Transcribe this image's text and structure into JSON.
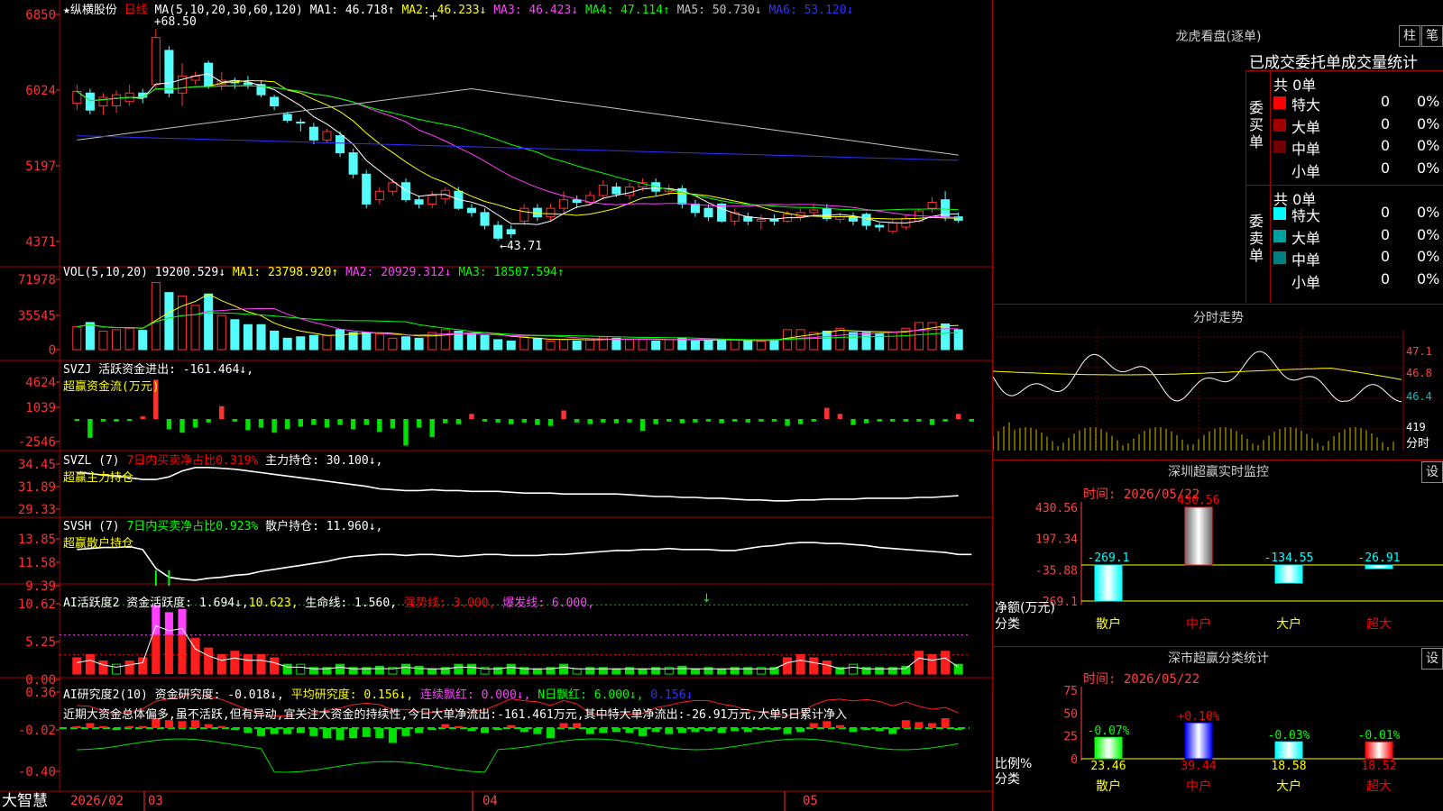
{
  "header": {
    "star": "★",
    "stock_name": "纵横股份",
    "period": "日线",
    "ma_label": "MA(5,10,20,30,60,120)",
    "ma_items": [
      {
        "label": "MA1: 46.718↑",
        "color": "#ffffff"
      },
      {
        "label": "MA2: 46.233↓",
        "color": "#ffff00"
      },
      {
        "label": "MA3: 46.423↓",
        "color": "#ff40ff"
      },
      {
        "label": "MA4: 47.114↑",
        "color": "#00ff00"
      },
      {
        "label": "MA5: 50.730↓",
        "color": "#c0c0c0"
      },
      {
        "label": "MA6: 53.120↓",
        "color": "#3030ff"
      }
    ]
  },
  "volume": {
    "label": "VOL(5,10,20)",
    "items": [
      {
        "label": "19200.529↓",
        "color": "#ffffff"
      },
      {
        "label": "MA1: 23798.920↑",
        "color": "#ffff00"
      },
      {
        "label": "MA2: 20929.312↓",
        "color": "#ff40ff"
      },
      {
        "label": "MA3: 18507.594↑",
        "color": "#00ff00"
      }
    ],
    "ticks": [
      "71978",
      "35545",
      "0"
    ]
  },
  "svzj": {
    "label": "SVZJ  活跃资金进出: -161.464↓,",
    "sub": "超赢资金流(万元)",
    "ticks": [
      "4624",
      "1039",
      "-2546"
    ]
  },
  "svzl": {
    "label": "SVZL (7)",
    "red_part": "7日内买卖净占比0.319%",
    "rest": "主力持仓: 30.100↓,",
    "sub": "超赢主力持仓",
    "ticks": [
      "34.45",
      "31.89",
      "29.33"
    ]
  },
  "svsh": {
    "label": "SVSH (7)",
    "green_part": "7日内买卖净占比0.923%",
    "rest": "散户持仓: 11.960↓,",
    "sub": "超赢散户持仓",
    "ticks": [
      "13.85",
      "11.58",
      "9.39"
    ]
  },
  "ai1": {
    "label": "AI活跃度2 资金活跃度: 1.694↓,",
    "val2": "10.623,",
    "life": "生命线: 1.560,",
    "strong": "强势线: 3.000,",
    "burst": "爆发线: 6.000,",
    "ticks": [
      "10.62",
      "5.25",
      "0.00"
    ]
  },
  "ai2": {
    "label": "AI研究度2(10) 资金研究度: -0.018↓,",
    "avg": "平均研究度: 0.156↓,",
    "cont": "连续飘红: 0.000↓,",
    "nday": "N日飘红: 6.000↓,",
    "last": "0.156↓",
    "text": "近期大资金总体偏多,虽不活跃,但有异动,宜关注大资金的持续性,今日大单净流出:-161.461万元,其中特大单净流出:-26.91万元,大单5日累计净入",
    "ticks": [
      "0.36",
      "-0.02",
      "-0.40"
    ]
  },
  "bottom": {
    "logo": "大智慧",
    "year": "2026/02",
    "m3": "03",
    "m4": "04",
    "m5": "05"
  },
  "chart_data": {
    "type": "candlestick",
    "y_ticks": [
      "6850",
      "6024",
      "5197",
      "4371"
    ],
    "high_label": "68.50",
    "low_label": "←43.71",
    "candles": [
      {
        "o": 59.8,
        "c": 61.2,
        "h": 62.0,
        "l": 59.0
      },
      {
        "o": 61.0,
        "c": 59.0,
        "h": 61.5,
        "l": 58.5
      },
      {
        "o": 59.5,
        "c": 60.5,
        "h": 61.0,
        "l": 58.5
      },
      {
        "o": 59.5,
        "c": 60.8,
        "h": 61.3,
        "l": 58.7
      },
      {
        "o": 60.0,
        "c": 61.0,
        "h": 62.0,
        "l": 59.5
      },
      {
        "o": 61.0,
        "c": 60.5,
        "h": 61.5,
        "l": 59.8
      },
      {
        "o": 62.0,
        "c": 67.5,
        "h": 68.5,
        "l": 61.5
      },
      {
        "o": 66.0,
        "c": 61.0,
        "h": 66.5,
        "l": 60.5
      },
      {
        "o": 61.0,
        "c": 63.0,
        "h": 64.5,
        "l": 59.5
      },
      {
        "o": 62.5,
        "c": 63.0,
        "h": 63.5,
        "l": 62.0
      },
      {
        "o": 64.5,
        "c": 61.8,
        "h": 64.8,
        "l": 61.5
      },
      {
        "o": 62.0,
        "c": 62.5,
        "h": 63.5,
        "l": 61.3
      },
      {
        "o": 62.3,
        "c": 62.2,
        "h": 62.8,
        "l": 61.5
      },
      {
        "o": 62.2,
        "c": 62.0,
        "h": 63.0,
        "l": 61.5
      },
      {
        "o": 62.0,
        "c": 60.8,
        "h": 62.5,
        "l": 60.5
      },
      {
        "o": 60.5,
        "c": 59.5,
        "h": 60.8,
        "l": 59.0
      },
      {
        "o": 58.5,
        "c": 57.8,
        "h": 58.8,
        "l": 57.5
      },
      {
        "o": 57.6,
        "c": 57.5,
        "h": 58.0,
        "l": 56.5
      },
      {
        "o": 57.0,
        "c": 55.5,
        "h": 57.5,
        "l": 55.0
      },
      {
        "o": 55.5,
        "c": 56.5,
        "h": 56.8,
        "l": 55.2
      },
      {
        "o": 56.0,
        "c": 54.0,
        "h": 56.5,
        "l": 53.5
      },
      {
        "o": 54.0,
        "c": 51.5,
        "h": 54.5,
        "l": 51.0
      },
      {
        "o": 51.5,
        "c": 48.0,
        "h": 52.0,
        "l": 47.5
      },
      {
        "o": 48.5,
        "c": 49.5,
        "h": 50.0,
        "l": 48.0
      },
      {
        "o": 49.5,
        "c": 50.5,
        "h": 51.0,
        "l": 49.0
      },
      {
        "o": 50.5,
        "c": 48.5,
        "h": 51.0,
        "l": 48.2
      },
      {
        "o": 48.5,
        "c": 48.0,
        "h": 49.0,
        "l": 47.5
      },
      {
        "o": 48.0,
        "c": 49.0,
        "h": 49.5,
        "l": 47.5
      },
      {
        "o": 48.6,
        "c": 49.6,
        "h": 50.0,
        "l": 48.0
      },
      {
        "o": 49.5,
        "c": 47.5,
        "h": 50.0,
        "l": 47.3
      },
      {
        "o": 47.5,
        "c": 47.0,
        "h": 48.0,
        "l": 46.5
      },
      {
        "o": 47.0,
        "c": 45.5,
        "h": 47.5,
        "l": 45.0
      },
      {
        "o": 45.5,
        "c": 44.0,
        "h": 46.0,
        "l": 43.71
      },
      {
        "o": 45.0,
        "c": 44.5,
        "h": 45.5,
        "l": 44.0
      },
      {
        "o": 46.0,
        "c": 47.5,
        "h": 48.0,
        "l": 45.5
      },
      {
        "o": 47.5,
        "c": 46.5,
        "h": 48.0,
        "l": 46.0
      },
      {
        "o": 46.5,
        "c": 47.5,
        "h": 48.0,
        "l": 46.0
      },
      {
        "o": 47.5,
        "c": 48.5,
        "h": 49.5,
        "l": 47.0
      },
      {
        "o": 48.5,
        "c": 48.2,
        "h": 49.0,
        "l": 47.5
      },
      {
        "o": 48.2,
        "c": 49.0,
        "h": 49.5,
        "l": 47.8
      },
      {
        "o": 49.0,
        "c": 50.2,
        "h": 50.8,
        "l": 48.5
      },
      {
        "o": 50.0,
        "c": 49.2,
        "h": 50.5,
        "l": 48.8
      },
      {
        "o": 49.0,
        "c": 50.0,
        "h": 50.5,
        "l": 48.5
      },
      {
        "o": 50.0,
        "c": 50.5,
        "h": 51.0,
        "l": 49.5
      },
      {
        "o": 50.5,
        "c": 49.5,
        "h": 51.0,
        "l": 49.0
      },
      {
        "o": 49.5,
        "c": 49.8,
        "h": 50.3,
        "l": 49.0
      },
      {
        "o": 49.8,
        "c": 48.0,
        "h": 50.2,
        "l": 47.5
      },
      {
        "o": 48.0,
        "c": 47.0,
        "h": 48.5,
        "l": 46.5
      },
      {
        "o": 47.5,
        "c": 46.5,
        "h": 48.0,
        "l": 46.0
      },
      {
        "o": 48.0,
        "c": 46.0,
        "h": 48.2,
        "l": 45.8
      },
      {
        "o": 46.0,
        "c": 47.0,
        "h": 47.5,
        "l": 45.5
      },
      {
        "o": 46.5,
        "c": 46.0,
        "h": 47.0,
        "l": 45.5
      },
      {
        "o": 46.0,
        "c": 46.2,
        "h": 46.8,
        "l": 45.0
      },
      {
        "o": 46.2,
        "c": 46.0,
        "h": 46.8,
        "l": 45.5
      },
      {
        "o": 46.0,
        "c": 46.8,
        "h": 47.2,
        "l": 45.8
      },
      {
        "o": 46.5,
        "c": 47.0,
        "h": 47.5,
        "l": 46.0
      },
      {
        "o": 47.0,
        "c": 47.3,
        "h": 48.0,
        "l": 46.5
      },
      {
        "o": 47.5,
        "c": 46.3,
        "h": 48.0,
        "l": 46.0
      },
      {
        "o": 46.2,
        "c": 46.5,
        "h": 47.0,
        "l": 45.8
      },
      {
        "o": 46.5,
        "c": 46.0,
        "h": 47.0,
        "l": 45.5
      },
      {
        "o": 46.8,
        "c": 45.5,
        "h": 47.0,
        "l": 45.0
      },
      {
        "o": 45.5,
        "c": 45.3,
        "h": 45.8,
        "l": 44.8
      },
      {
        "o": 44.8,
        "c": 45.8,
        "h": 46.2,
        "l": 44.5
      },
      {
        "o": 45.3,
        "c": 46.3,
        "h": 46.8,
        "l": 45.0
      },
      {
        "o": 46.0,
        "c": 47.2,
        "h": 47.5,
        "l": 45.8
      },
      {
        "o": 47.5,
        "c": 48.2,
        "h": 48.8,
        "l": 47.0
      },
      {
        "o": 48.5,
        "c": 46.5,
        "h": 49.5,
        "l": 46.0
      },
      {
        "o": 46.5,
        "c": 46.1,
        "h": 47.0,
        "l": 45.8
      }
    ],
    "volume": [
      32,
      38,
      26,
      28,
      30,
      27,
      94,
      80,
      75,
      62,
      78,
      48,
      42,
      35,
      35,
      26,
      16,
      18,
      20,
      20,
      28,
      24,
      24,
      22,
      16,
      18,
      16,
      24,
      28,
      26,
      22,
      20,
      14,
      12,
      18,
      16,
      12,
      14,
      12,
      14,
      18,
      16,
      14,
      14,
      12,
      14,
      16,
      12,
      12,
      14,
      14,
      12,
      12,
      14,
      28,
      28,
      24,
      26,
      30,
      24,
      24,
      22,
      24,
      30,
      38,
      38,
      36,
      28
    ],
    "svzj": [
      -200,
      -2200,
      -300,
      -300,
      -200,
      300,
      4600,
      -1200,
      -1600,
      -1000,
      -400,
      1500,
      -300,
      -1300,
      -1000,
      -1600,
      -1200,
      -900,
      -700,
      -1000,
      -700,
      -1200,
      -700,
      -1500,
      -1100,
      -3100,
      -1000,
      -2100,
      -500,
      -600,
      600,
      -300,
      -400,
      -600,
      -400,
      -700,
      -800,
      1000,
      -400,
      -600,
      -400,
      -500,
      -400,
      -1400,
      -600,
      -300,
      -500,
      -400,
      -300,
      -500,
      -300,
      -400,
      -300,
      -300,
      -800,
      -600,
      -300,
      1300,
      600,
      -700,
      -500,
      -300,
      -300,
      -300,
      -300,
      -700,
      -300,
      600,
      -300
    ],
    "svzl": [
      33.8,
      33.7,
      33.5,
      33.4,
      33.2,
      33.0,
      33.0,
      33.3,
      34.0,
      34.4,
      34.4,
      34.3,
      34.2,
      34.0,
      33.8,
      33.6,
      33.4,
      33.2,
      33.0,
      32.8,
      32.6,
      32.4,
      32.2,
      31.9,
      31.8,
      31.7,
      31.7,
      31.8,
      31.7,
      31.7,
      31.6,
      31.6,
      31.6,
      31.5,
      31.4,
      31.4,
      31.4,
      31.3,
      31.3,
      31.3,
      31.3,
      31.3,
      31.2,
      31.1,
      31.0,
      31.0,
      30.9,
      30.9,
      30.8,
      30.8,
      30.7,
      30.6,
      30.6,
      30.5,
      30.5,
      30.6,
      30.6,
      30.7,
      30.7,
      30.7,
      30.8,
      30.8,
      30.8,
      30.8,
      30.9,
      30.9,
      31.0,
      31.1
    ],
    "svsh": [
      12.4,
      12.5,
      12.6,
      12.6,
      12.7,
      12.4,
      10.5,
      9.6,
      9.4,
      9.3,
      9.5,
      9.6,
      9.8,
      9.9,
      10.2,
      10.4,
      10.6,
      10.8,
      11.0,
      11.2,
      11.5,
      11.7,
      11.8,
      11.9,
      11.9,
      11.8,
      11.9,
      11.9,
      11.8,
      11.7,
      11.8,
      11.9,
      11.9,
      11.8,
      11.8,
      11.8,
      11.9,
      11.9,
      12.0,
      12.1,
      12.2,
      12.3,
      12.3,
      12.4,
      12.4,
      12.5,
      12.4,
      12.4,
      12.4,
      12.3,
      12.3,
      12.5,
      12.7,
      12.8,
      13.0,
      13.1,
      13.1,
      13.0,
      13.0,
      12.9,
      12.8,
      12.6,
      12.5,
      12.4,
      12.3,
      12.2,
      12.1,
      11.9,
      11.9
    ],
    "ai1": [
      2.5,
      3.0,
      2.0,
      1.5,
      2.0,
      2.5,
      10.6,
      9.5,
      10.0,
      5.5,
      4.0,
      3.0,
      3.5,
      3.0,
      3.0,
      2.5,
      1.5,
      1.5,
      1.0,
      1.0,
      1.5,
      1.0,
      1.0,
      1.2,
      1.0,
      1.5,
      1.2,
      0.8,
      1.0,
      1.5,
      1.5,
      1.0,
      1.0,
      1.5,
      1.0,
      0.8,
      1.0,
      1.5,
      0.8,
      1.0,
      1.0,
      0.8,
      1.0,
      0.8,
      1.0,
      1.0,
      1.2,
      0.8,
      1.0,
      0.8,
      1.0,
      1.0,
      1.0,
      1.0,
      2.5,
      3.0,
      2.5,
      2.0,
      1.0,
      1.5,
      1.0,
      1.0,
      1.0,
      1.2,
      3.5,
      3.0,
      3.5,
      1.5
    ],
    "ai2": [
      0.0,
      0.05,
      0.0,
      -0.02,
      0.0,
      0.02,
      0.1,
      0.08,
      0.07,
      0.08,
      0.04,
      0.02,
      -0.02,
      -0.05,
      -0.08,
      -0.06,
      -0.06,
      -0.05,
      -0.08,
      -0.1,
      -0.12,
      -0.1,
      -0.09,
      -0.1,
      -0.15,
      -0.08,
      -0.05,
      -0.02,
      0.04,
      0.02,
      -0.03,
      -0.05,
      -0.02,
      0.03,
      -0.04,
      -0.06,
      -0.1,
      0.05,
      0.05,
      -0.06,
      -0.05,
      -0.04,
      -0.05,
      -0.08,
      -0.04,
      -0.06,
      -0.05,
      -0.04,
      -0.03,
      -0.05,
      -0.03,
      -0.04,
      -0.02,
      -0.02,
      -0.06,
      -0.04,
      0.05,
      0.07,
      0.03,
      -0.04,
      -0.02,
      -0.03,
      -0.06,
      0.08,
      0.06,
      0.05,
      0.1,
      -0.02
    ]
  },
  "sidebar": {
    "dragon_title": "龙虎看盘(逐单)",
    "btn_col": "柱",
    "btn_pen": "笔",
    "table_header": "已成交委托单成交量统计",
    "buy_label": "委买单",
    "buy_total": "共 0单",
    "sell_label": "委卖单",
    "sell_total": "共 0单",
    "buy_rows": [
      {
        "name": "特大",
        "val": "0",
        "pct": "0%",
        "color": "#ff0000"
      },
      {
        "name": "大单",
        "val": "0",
        "pct": "0%",
        "color": "#a00000"
      },
      {
        "name": "中单",
        "val": "0",
        "pct": "0%",
        "color": "#700000"
      },
      {
        "name": "小单",
        "val": "0",
        "pct": "0%",
        "color": ""
      }
    ],
    "sell_rows": [
      {
        "name": "特大",
        "val": "0",
        "pct": "0%",
        "color": "#00ffff"
      },
      {
        "name": "大单",
        "val": "0",
        "pct": "0%",
        "color": "#00a0a0"
      },
      {
        "name": "中单",
        "val": "0",
        "pct": "0%",
        "color": "#008080"
      },
      {
        "name": "小单",
        "val": "0",
        "pct": "0%",
        "color": ""
      }
    ],
    "intraday_title": "分时走势",
    "intraday_ticks": [
      "47.1",
      "46.8",
      "46.4",
      "419"
    ],
    "intraday_minute": "分时",
    "monitor_title": "深圳超赢实时监控",
    "set_btn": "设",
    "monitor_time": "时间: 2026/05/22",
    "monitor_ticks": [
      "430.56",
      "197.34",
      "-35.88",
      "-269.1"
    ],
    "monitor_ylabel": "净额(万元)",
    "monitor_xlabel": "分类",
    "monitor_bars": [
      {
        "cat": "散户",
        "value": -269.1,
        "label": "-269.1",
        "cat_color": "#ffff00",
        "val_color": "#00ffff"
      },
      {
        "cat": "中户",
        "value": 430.56,
        "label": "430.56",
        "cat_color": "#ff0000",
        "val_color": "#ff0000"
      },
      {
        "cat": "大户",
        "value": -134.55,
        "label": "-134.55",
        "cat_color": "#ffff00",
        "val_color": "#00ffff"
      },
      {
        "cat": "超大",
        "value": -26.91,
        "label": "-26.91",
        "cat_color": "#ff0000",
        "val_color": "#00ffff"
      }
    ],
    "class_title": "深市超赢分类统计",
    "class_time": "时间: 2026/05/22",
    "class_ticks": [
      "75",
      "50",
      "25",
      "0"
    ],
    "class_ylabel": "比例%",
    "class_xlabel": "分类",
    "class_bars": [
      {
        "cat": "散户",
        "pct": 23.46,
        "pct_label": "23.46",
        "change": "-0.07%",
        "chg_color": "#00ff00",
        "cat_color": "#ffff00",
        "bar_color": "#00ff00"
      },
      {
        "cat": "中户",
        "pct": 39.44,
        "pct_label": "39.44",
        "change": "+0.10%",
        "chg_color": "#ff0000",
        "cat_color": "#ff0000",
        "bar_color": "#0000ff"
      },
      {
        "cat": "大户",
        "pct": 18.58,
        "pct_label": "18.58",
        "change": "-0.03%",
        "chg_color": "#00ff00",
        "cat_color": "#ffff00",
        "bar_color": "#00ffff"
      },
      {
        "cat": "超大",
        "pct": 18.52,
        "pct_label": "18.52",
        "change": "-0.01%",
        "chg_color": "#00ff00",
        "cat_color": "#ff0000",
        "bar_color": "#ff0000"
      }
    ]
  }
}
